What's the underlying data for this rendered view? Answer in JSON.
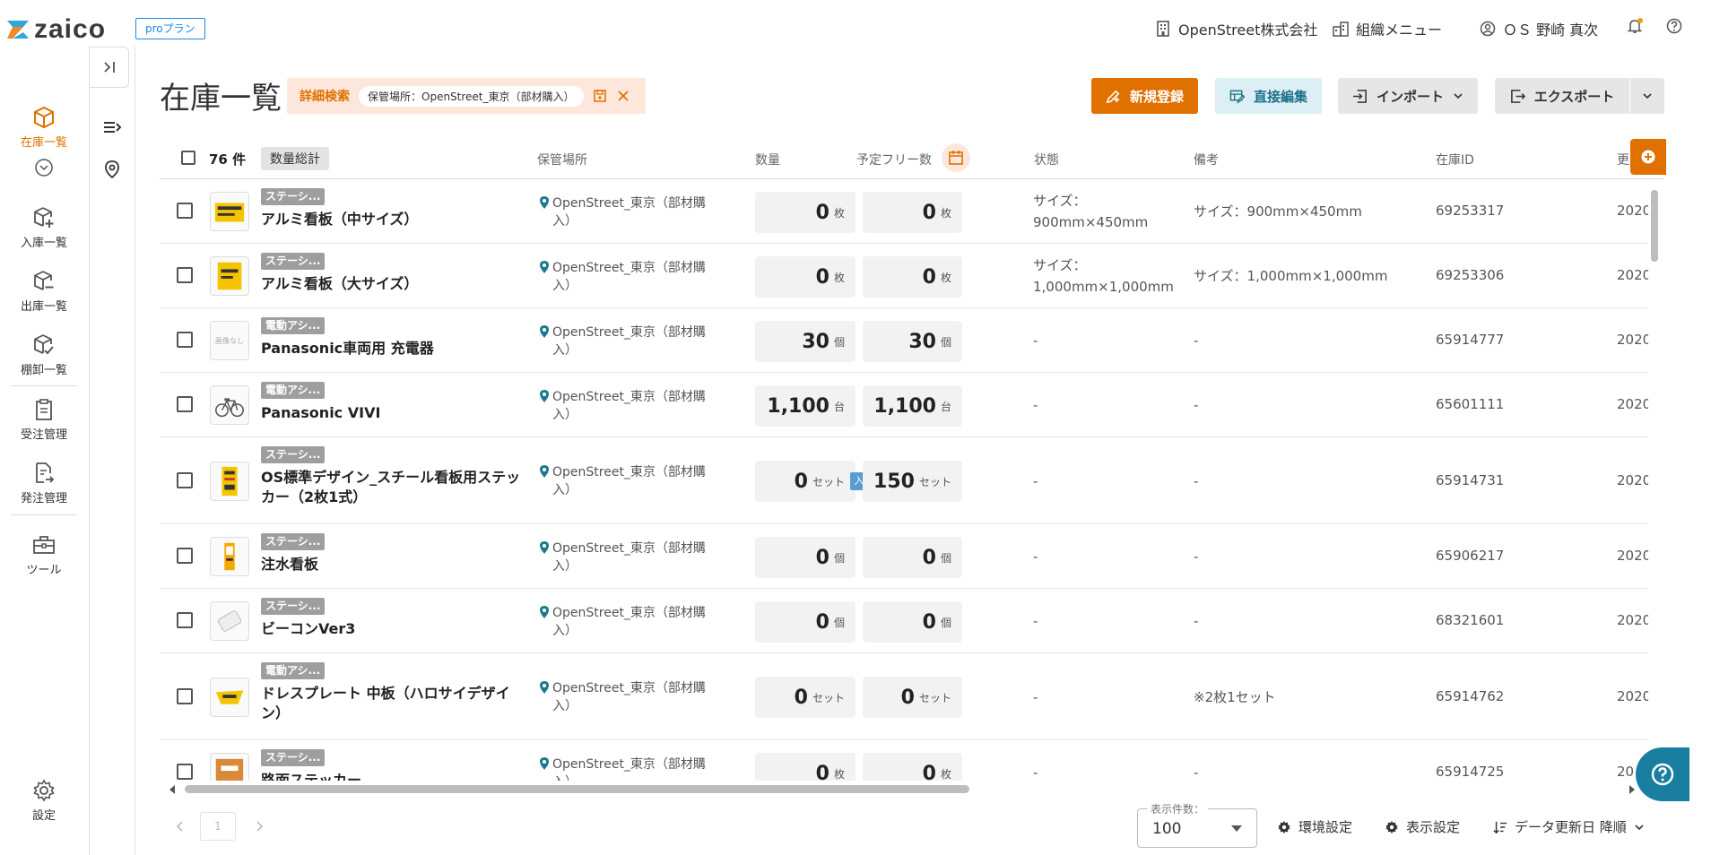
{
  "header": {
    "logo_text": "zaico",
    "plan": "proプラン",
    "company": "OpenStreet株式会社",
    "org_menu": "組織メニュー",
    "user": "ＯＳ 野崎 真次"
  },
  "nav": {
    "items": [
      {
        "label": "在庫一覧",
        "icon": "box-icon"
      },
      {
        "label": "入庫一覧",
        "icon": "box-add-icon"
      },
      {
        "label": "出庫一覧",
        "icon": "box-remove-icon"
      },
      {
        "label": "棚卸一覧",
        "icon": "box-check-icon"
      },
      {
        "label": "受注管理",
        "icon": "clipboard-icon"
      },
      {
        "label": "発注管理",
        "icon": "doc-arrow-icon"
      },
      {
        "label": "ツール",
        "icon": "toolbox-icon"
      },
      {
        "label": "設定",
        "icon": "gear-icon"
      }
    ]
  },
  "page": {
    "title": "在庫一覧",
    "filter_label": "詳細検索",
    "filter_chip": "保管場所：OpenStreet_東京（部材購入）",
    "btn_new": "新規登録",
    "btn_edit": "直接編集",
    "btn_import": "インポート",
    "btn_export": "エクスポート"
  },
  "table": {
    "count": "76 件",
    "qty_total": "数量総計",
    "headers": {
      "location": "保管場所",
      "qty": "数量",
      "free_qty": "予定フリー数",
      "state": "状態",
      "note": "備考",
      "id": "在庫ID",
      "updated": "更"
    },
    "rows": [
      {
        "category": "ステーシ...",
        "name": "アルミ看板（中サイズ）",
        "location": "OpenStreet_東京（部材購入）",
        "qty": "0",
        "free": "0",
        "unit": "枚",
        "state": "サイズ：900mm×450mm",
        "note": "サイズ：900mm×450mm",
        "id": "69253317",
        "date": "2020"
      },
      {
        "category": "ステーシ...",
        "name": "アルミ看板（大サイズ）",
        "location": "OpenStreet_東京（部材購入）",
        "qty": "0",
        "free": "0",
        "unit": "枚",
        "state": "サイズ：1,000mm×1,000mm",
        "note": "サイズ：1,000mm×1,000mm",
        "id": "69253306",
        "date": "2020"
      },
      {
        "category": "電動アシ...",
        "name": "Panasonic車両用 充電器",
        "location": "OpenStreet_東京（部材購入）",
        "qty": "30",
        "free": "30",
        "unit": "個",
        "state": "-",
        "note": "-",
        "id": "65914777",
        "date": "2020"
      },
      {
        "category": "電動アシ...",
        "name": "Panasonic VIVI",
        "location": "OpenStreet_東京（部材購入）",
        "qty": "1,100",
        "free": "1,100",
        "unit": "台",
        "state": "-",
        "note": "-",
        "id": "65601111",
        "date": "2020"
      },
      {
        "category": "ステーシ...",
        "name": "OS標準デザイン_スチール看板用ステッカー（2枚1式）",
        "location": "OpenStreet_東京（部材購入）",
        "qty": "0",
        "free": "150",
        "unit": "セット",
        "badge": "入",
        "state": "-",
        "note": "-",
        "id": "65914731",
        "date": "2020"
      },
      {
        "category": "ステーシ...",
        "name": "注水看板",
        "location": "OpenStreet_東京（部材購入）",
        "qty": "0",
        "free": "0",
        "unit": "個",
        "state": "-",
        "note": "-",
        "id": "65906217",
        "date": "2020"
      },
      {
        "category": "ステーシ...",
        "name": "ビーコンVer3",
        "location": "OpenStreet_東京（部材購入）",
        "qty": "0",
        "free": "0",
        "unit": "個",
        "state": "-",
        "note": "-",
        "id": "68321601",
        "date": "2020"
      },
      {
        "category": "電動アシ...",
        "name": "ドレスプレート 中板（ハロサイデザイン）",
        "location": "OpenStreet_東京（部材購入）",
        "qty": "0",
        "free": "0",
        "unit": "セット",
        "state": "-",
        "note": "※2枚1セット",
        "id": "65914762",
        "date": "2020"
      },
      {
        "category": "ステーシ...",
        "name": "路面ステッカー",
        "location": "OpenStreet_東京（部材購入）",
        "qty": "0",
        "free": "0",
        "unit": "枚",
        "state": "-",
        "note": "-",
        "id": "65914725",
        "date": "20"
      }
    ]
  },
  "footer": {
    "per_page_label": "表示件数：",
    "per_page": "100",
    "page_num": "1",
    "env_settings": "環境設定",
    "display_settings": "表示設定",
    "sort": "データ更新日 降順"
  },
  "thumb_no_image": "画像なし"
}
